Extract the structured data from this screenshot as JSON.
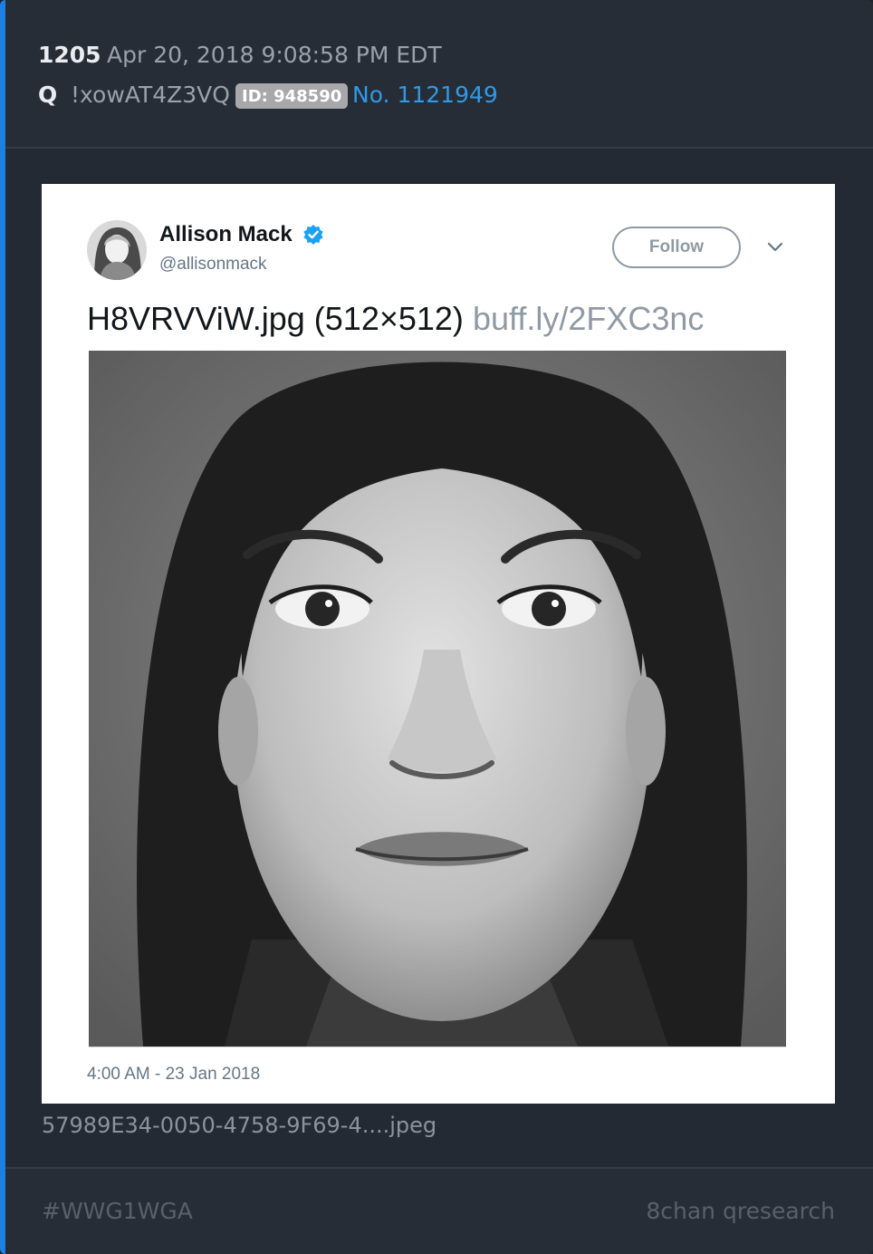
{
  "post": {
    "number": "1205",
    "date": "Apr 20, 2018 9:08:58 PM EDT",
    "author": "Q",
    "tripcode": "!xowAT4Z3VQ",
    "id_badge": "ID: 948590",
    "post_link": "No. 1121949"
  },
  "tweet": {
    "name": "Allison Mack",
    "handle": "@allisonmack",
    "follow_label": "Follow",
    "text": "H8VRVViW.jpg (512×512)",
    "link": "buff.ly/2FXC3nc",
    "timestamp": "4:00 AM - 23 Jan 2018",
    "icons": [
      "verified-icon",
      "chevron-down-icon"
    ],
    "colors": {
      "verified": "#1da1f2",
      "link": "#8f9aa4"
    }
  },
  "attachment": {
    "filename": "57989E34-0050-4758-9F69-4....jpeg"
  },
  "footer": {
    "hashtag": "#WWG1WGA",
    "source": "8chan qresearch"
  },
  "theme": {
    "accent": "#1d7fe2",
    "link": "#2f9ae6",
    "background": "#242a33"
  }
}
